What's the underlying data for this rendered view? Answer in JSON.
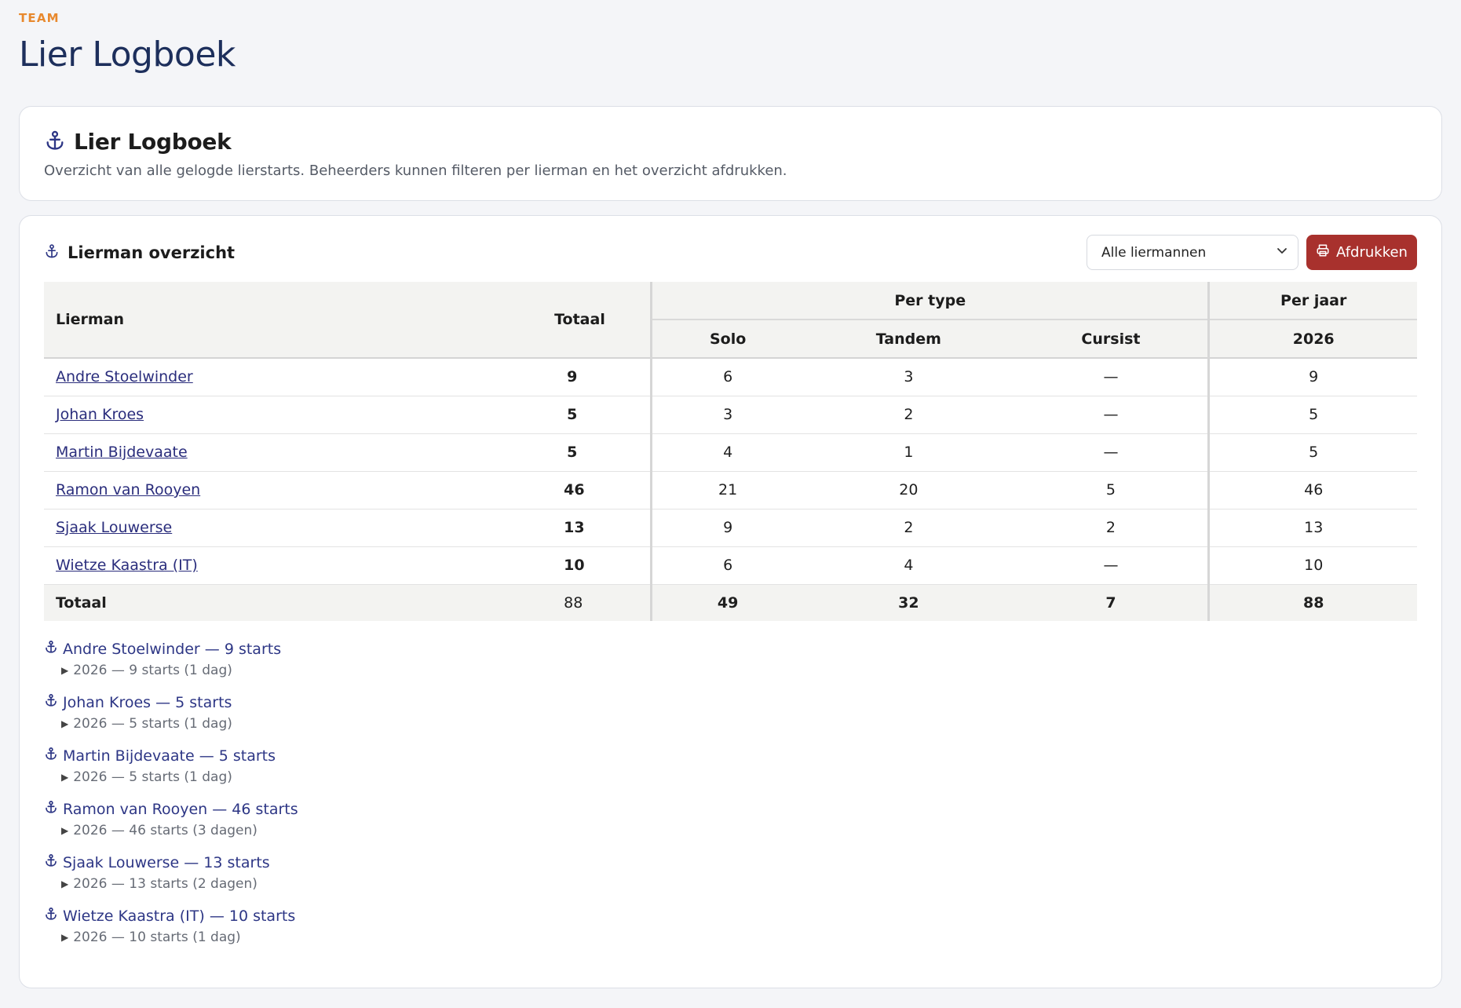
{
  "header": {
    "eyebrow": "TEAM",
    "title": "Lier Logboek"
  },
  "intro": {
    "title": "Lier Logboek",
    "description": "Overzicht van alle gelogde lierstarts. Beheerders kunnen filteren per lierman en het overzicht afdrukken."
  },
  "overview": {
    "title": "Lierman overzicht",
    "filter_value": "Alle liermannen",
    "print_label": "Afdrukken"
  },
  "table": {
    "headers": {
      "lierman": "Lierman",
      "totaal": "Totaal",
      "per_type": "Per type",
      "per_jaar": "Per jaar",
      "solo": "Solo",
      "tandem": "Tandem",
      "cursist": "Cursist",
      "year": "2026"
    },
    "rows": [
      {
        "name": "Andre Stoelwinder",
        "totaal": "9",
        "solo": "6",
        "tandem": "3",
        "cursist": "—",
        "year": "9"
      },
      {
        "name": "Johan Kroes",
        "totaal": "5",
        "solo": "3",
        "tandem": "2",
        "cursist": "—",
        "year": "5"
      },
      {
        "name": "Martin Bijdevaate",
        "totaal": "5",
        "solo": "4",
        "tandem": "1",
        "cursist": "—",
        "year": "5"
      },
      {
        "name": "Ramon van Rooyen",
        "totaal": "46",
        "solo": "21",
        "tandem": "20",
        "cursist": "5",
        "year": "46"
      },
      {
        "name": "Sjaak Louwerse",
        "totaal": "13",
        "solo": "9",
        "tandem": "2",
        "cursist": "2",
        "year": "13"
      },
      {
        "name": "Wietze Kaastra (IT)",
        "totaal": "10",
        "solo": "6",
        "tandem": "4",
        "cursist": "—",
        "year": "10"
      }
    ],
    "footer": {
      "label": "Totaal",
      "totaal": "88",
      "solo": "49",
      "tandem": "32",
      "cursist": "7",
      "year": "88"
    }
  },
  "groups": [
    {
      "title": "Andre Stoelwinder — 9 starts",
      "summary": "2026 — 9 starts (1 dag)"
    },
    {
      "title": "Johan Kroes — 5 starts",
      "summary": "2026 — 5 starts (1 dag)"
    },
    {
      "title": "Martin Bijdevaate — 5 starts",
      "summary": "2026 — 5 starts (1 dag)"
    },
    {
      "title": "Ramon van Rooyen — 46 starts",
      "summary": "2026 — 46 starts (3 dagen)"
    },
    {
      "title": "Sjaak Louwerse — 13 starts",
      "summary": "2026 — 13 starts (2 dagen)"
    },
    {
      "title": "Wietze Kaastra (IT) — 10 starts",
      "summary": "2026 — 10 starts (1 dag)"
    }
  ],
  "icons": {
    "anchor": "anchor-icon",
    "printer": "printer-icon",
    "chevron": "chevron-down-icon",
    "disclosure": "triangle-right-icon"
  },
  "colors": {
    "accent": "#e8892e",
    "title": "#1d2f5c",
    "link": "#2a2d7c",
    "print_button": "#a8312d"
  }
}
